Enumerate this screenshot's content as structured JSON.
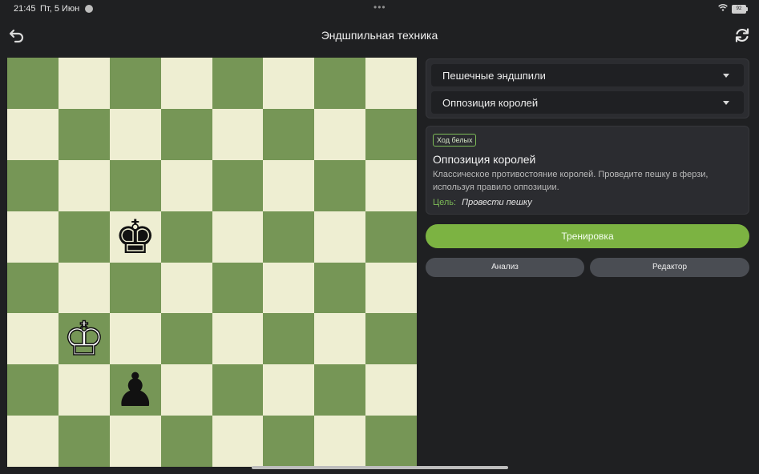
{
  "status_bar": {
    "time": "21:45",
    "date": "Пт, 5 Июн",
    "dots": "•••",
    "battery": "92"
  },
  "header": {
    "title": "Эндшпильная техника",
    "back_icon": "back-arrow-icon",
    "refresh_icon": "refresh-icon"
  },
  "board": {
    "light_color": "#eeeed2",
    "dark_color": "#769656",
    "pieces": {
      "c5": "♚",
      "b3": "♔",
      "c2": "♟"
    }
  },
  "selects": {
    "category": "Пешечные эндшпили",
    "lesson": "Оппозиция королей"
  },
  "info": {
    "turn_badge": "Ход белых",
    "title": "Оппозиция королей",
    "description": "Классическое противостояние королей. Проведите пешку в ферзи, используя правило оппозиции.",
    "goal_label": "Цель:",
    "goal_value": "Провести пешку"
  },
  "buttons": {
    "train": "Тренировка",
    "analysis": "Анализ",
    "editor": "Редактор"
  },
  "colors": {
    "accent": "#7cb342",
    "background": "#1f2022"
  }
}
